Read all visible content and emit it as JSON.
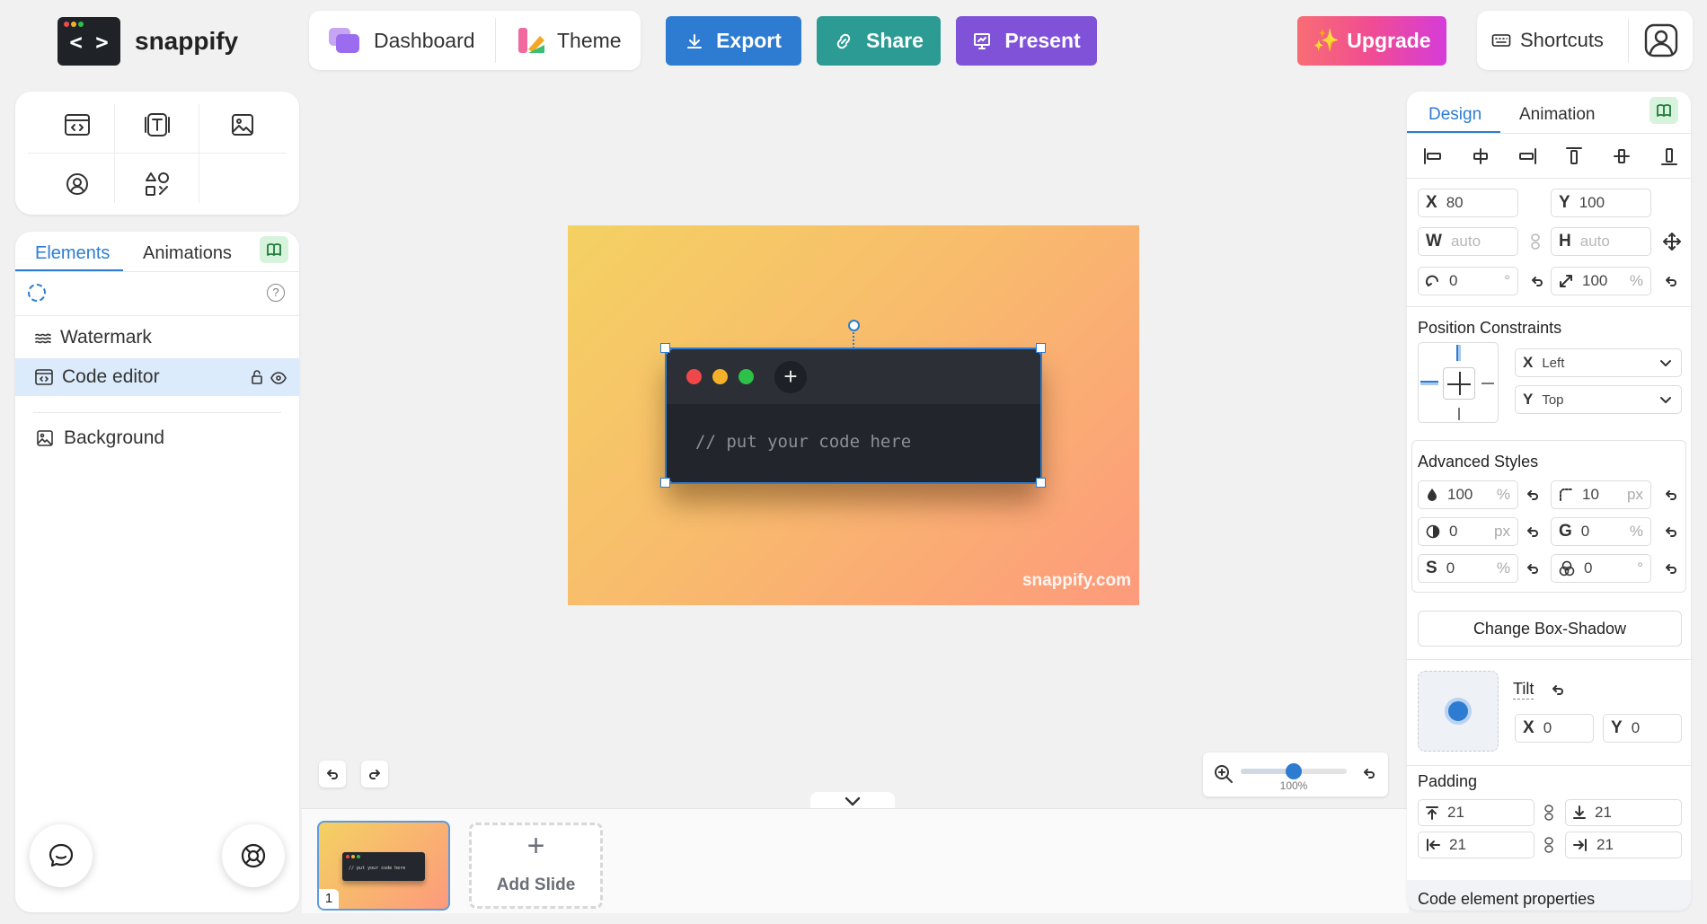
{
  "app": {
    "name": "snappify",
    "logo_glyph": "< >"
  },
  "topbar": {
    "dashboard": "Dashboard",
    "theme": "Theme",
    "export": "Export",
    "share": "Share",
    "present": "Present",
    "upgrade": "Upgrade",
    "shortcuts": "Shortcuts"
  },
  "colors": {
    "export": "#2d7cd1",
    "share": "#2b9b94",
    "present": "#8052d8",
    "accent": "#2d7cd1"
  },
  "left_panel": {
    "tabs": [
      "Elements",
      "Animations"
    ],
    "layers": [
      {
        "label": "Watermark",
        "icon": "waves-icon"
      },
      {
        "label": "Code editor",
        "icon": "code-window-icon"
      },
      {
        "label": "Background",
        "icon": "image-icon"
      }
    ]
  },
  "canvas": {
    "code_placeholder": "// put your code here",
    "watermark": "snappify.com",
    "zoom": "100%",
    "zoom_level": 0.5
  },
  "slides": {
    "current_number": "1",
    "add_label": "Add Slide",
    "thumb_code": "// put your code here"
  },
  "right_panel": {
    "tabs": [
      "Design",
      "Animation"
    ],
    "x": "80",
    "y": "100",
    "w_placeholder": "auto",
    "h_placeholder": "auto",
    "rotation": "0",
    "rotation_unit": "°",
    "scale": "100",
    "scale_unit": "%",
    "position_constraints_title": "Position Constraints",
    "constraint_x": "Left",
    "constraint_y": "Top",
    "advanced_title": "Advanced Styles",
    "opacity": "100",
    "radius": "10",
    "blur": "0",
    "grayscale": "0",
    "saturation": "0",
    "hue": "0",
    "unit_pct": "%",
    "unit_px": "px",
    "unit_deg": "°",
    "change_shadow": "Change Box-Shadow",
    "tilt_title": "Tilt",
    "tilt_x": "0",
    "tilt_y": "0",
    "padding_title": "Padding",
    "pad_top": "21",
    "pad_bottom": "21",
    "pad_left": "21",
    "pad_right": "21",
    "code_props_title": "Code element properties",
    "labels": {
      "x": "X",
      "y": "Y",
      "w": "W",
      "h": "H",
      "g": "G",
      "s": "S"
    }
  }
}
